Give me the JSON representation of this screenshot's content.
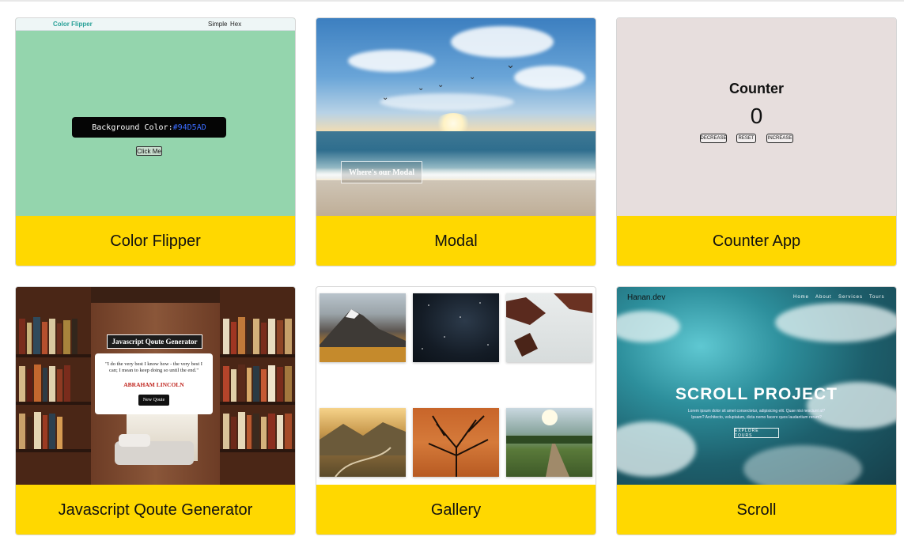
{
  "cards": [
    {
      "caption": "Color Flipper",
      "preview": {
        "logo": "Color Flipper",
        "nav_links": [
          "Simple",
          "Hex"
        ],
        "label": "Background Color:",
        "hex": "#94D5AD",
        "button": "Click Me",
        "bg_color": "#94d5ad"
      }
    },
    {
      "caption": "Modal",
      "preview": {
        "button": "Where's our Modal"
      }
    },
    {
      "caption": "Counter App",
      "preview": {
        "title": "Counter",
        "value": "0",
        "buttons": [
          "DECREASE",
          "RESET",
          "INCREASE"
        ]
      }
    },
    {
      "caption": "Javascript Qoute Generator",
      "preview": {
        "title": "Javascript Qoute Generator",
        "quote": "\"I do the very best I know how - the very best I can; I mean to keep doing so until the end.\"",
        "author": "ABRAHAM LINCOLN",
        "button": "New Qoute"
      }
    },
    {
      "caption": "Gallery",
      "preview": {
        "images": [
          "mountain-autumn",
          "night-sky",
          "snowy-trees",
          "valley-road",
          "tree-branches",
          "garden-sun"
        ]
      }
    },
    {
      "caption": "Scroll",
      "preview": {
        "logo": "Hanan.dev",
        "nav_links": [
          "Home",
          "About",
          "Services",
          "Tours"
        ],
        "title": "SCROLL PROJECT",
        "subtitle": "Lorem ipsum dolor sit amet consectetur, adipisicing elit. Quae nisi nesciunt at? Ipsam? Architecto, voluptatum, dicta nemo facere quos laudantium rerum?",
        "button": "EXPLORE TOURS"
      }
    }
  ],
  "colors": {
    "caption_bg": "#ffd800",
    "card_border": "#d6d6d6"
  }
}
